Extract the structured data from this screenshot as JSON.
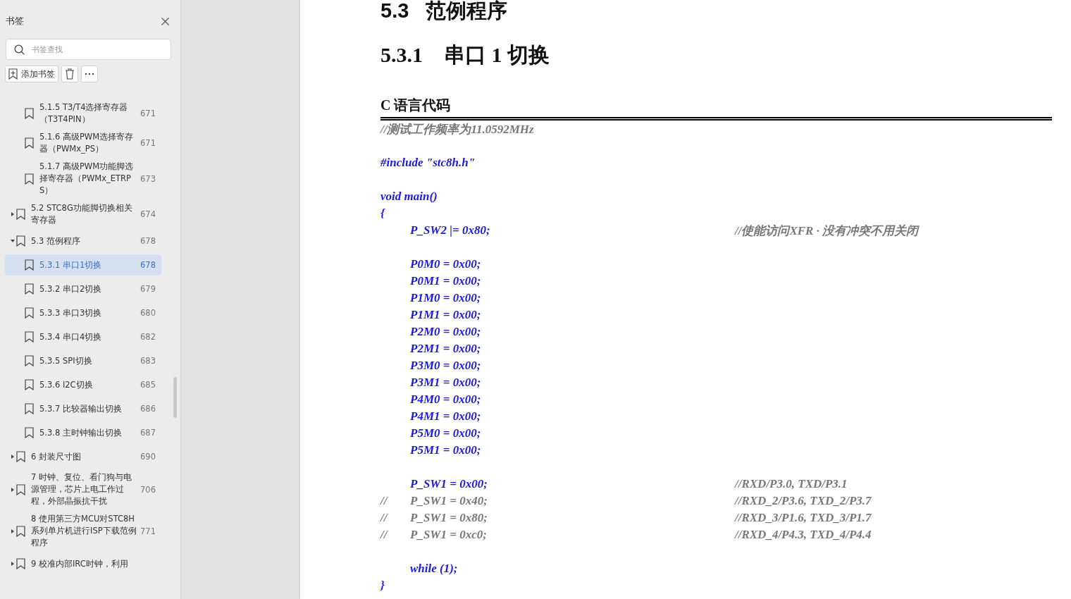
{
  "sidebar": {
    "title": "书签",
    "search": {
      "placeholder": "书签查找"
    },
    "toolbar": {
      "add_label": "添加书签"
    },
    "continued": [
      {
        "label": "5.1.5 T3/T4选择寄存器（T3T4PIN）",
        "page": "671",
        "selected": false
      },
      {
        "label": "5.1.6 高级PWM选择寄存器（PWMx_PS）",
        "page": "671",
        "selected": false
      },
      {
        "label": "5.1.7  高级PWM功能脚选择寄存器（PWMx_ETRPS）",
        "page": "673",
        "selected": false
      }
    ],
    "items": [
      {
        "label": "5.2  STC8G功能脚切换相关寄存器",
        "page": "674",
        "selected": false,
        "expanded": false
      },
      {
        "label": "5.3  范例程序",
        "page": "678",
        "selected": false,
        "expanded": true,
        "children": [
          {
            "label": "5.3.1 串口1切换",
            "page": "678",
            "selected": true
          },
          {
            "label": "5.3.2 串口2切换",
            "page": "679",
            "selected": false
          },
          {
            "label": "5.3.3 串口3切换",
            "page": "680",
            "selected": false
          },
          {
            "label": "5.3.4 串口4切换",
            "page": "682",
            "selected": false
          },
          {
            "label": "5.3.5 SPI切换",
            "page": "683",
            "selected": false
          },
          {
            "label": "5.3.6 I2C切换",
            "page": "685",
            "selected": false
          },
          {
            "label": "5.3.7 比较器输出切换",
            "page": "686",
            "selected": false
          },
          {
            "label": "5.3.8 主时钟输出切换",
            "page": "687",
            "selected": false
          }
        ]
      },
      {
        "label": "6  封装尺寸图",
        "page": "690",
        "selected": false,
        "expanded": false
      },
      {
        "label": "7  时钟、复位、看门狗与电源管理，芯片上电工作过程，外部晶振抗干扰",
        "page": "706",
        "selected": false,
        "expanded": false
      },
      {
        "label": "8  使用第三方MCU对STC8H系列单片机进行ISP下载范例程序",
        "page": "771",
        "selected": false,
        "expanded": false
      },
      {
        "label": "9  校准内部IRC时钟，利用",
        "selected": false,
        "expanded": false
      }
    ]
  },
  "document": {
    "section": "5.3   范例程序",
    "subsection": "5.3.1    串口 1 切换",
    "code_title": "C 语言代码",
    "lines": [
      {
        "kind": "comment",
        "code": "//测试工作频率为11.0592MHz"
      },
      {
        "kind": "blank"
      },
      {
        "kind": "code",
        "code": "#include \"stc8h.h\""
      },
      {
        "kind": "blank"
      },
      {
        "kind": "code",
        "code": "void main()"
      },
      {
        "kind": "code",
        "code": "{"
      },
      {
        "kind": "indented",
        "code": "P_SW2 |= 0x80;",
        "comment": "//使能访问XFR · 没有冲突不用关闭"
      },
      {
        "kind": "blank"
      },
      {
        "kind": "indented",
        "code": "P0M0 = 0x00;"
      },
      {
        "kind": "indented",
        "code": "P0M1 = 0x00;"
      },
      {
        "kind": "indented",
        "code": "P1M0 = 0x00;"
      },
      {
        "kind": "indented",
        "code": "P1M1 = 0x00;"
      },
      {
        "kind": "indented",
        "code": "P2M0 = 0x00;"
      },
      {
        "kind": "indented",
        "code": "P2M1 = 0x00;"
      },
      {
        "kind": "indented",
        "code": "P3M0 = 0x00;"
      },
      {
        "kind": "indented",
        "code": "P3M1 = 0x00;"
      },
      {
        "kind": "indented",
        "code": "P4M0 = 0x00;"
      },
      {
        "kind": "indented",
        "code": "P4M1 = 0x00;"
      },
      {
        "kind": "indented",
        "code": "P5M0 = 0x00;"
      },
      {
        "kind": "indented",
        "code": "P5M1 = 0x00;"
      },
      {
        "kind": "blank"
      },
      {
        "kind": "indented",
        "code": "P_SW1 = 0x00;",
        "comment": "//RXD/P3.0, TXD/P3.1"
      },
      {
        "kind": "disabled",
        "prefix": "//",
        "code": "P_SW1 = 0x40;",
        "comment": "//RXD_2/P3.6, TXD_2/P3.7"
      },
      {
        "kind": "disabled",
        "prefix": "//",
        "code": "P_SW1 = 0x80;",
        "comment": "//RXD_3/P1.6, TXD_3/P1.7"
      },
      {
        "kind": "disabled",
        "prefix": "//",
        "code": "P_SW1 = 0xc0;",
        "comment": "//RXD_4/P4.3, TXD_4/P4.4"
      },
      {
        "kind": "blank"
      },
      {
        "kind": "indented",
        "code": "while (1);"
      },
      {
        "kind": "code",
        "code": "}"
      }
    ]
  }
}
